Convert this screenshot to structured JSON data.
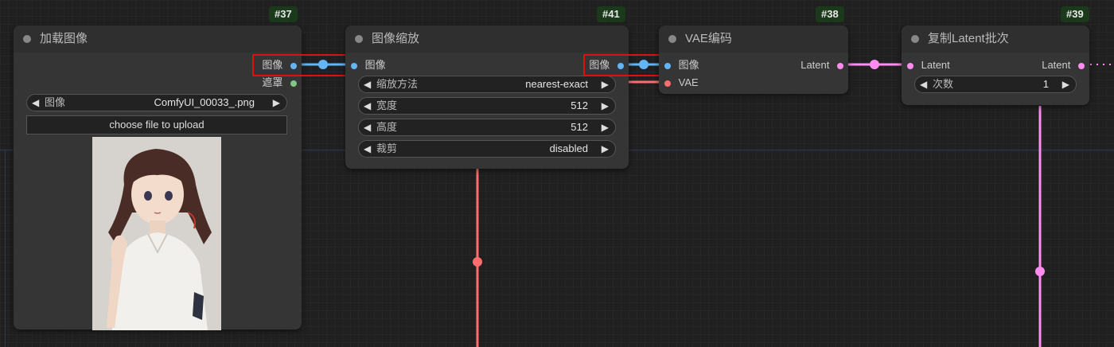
{
  "canvas": {
    "background": "#202020",
    "grid_color": "#2c2c2c"
  },
  "colors": {
    "image_link": "#64b5f6",
    "latent_link": "#ff8cf0",
    "vae_link": "#ff6e6e",
    "mask_slot": "#81c784",
    "highlight": "#e01010",
    "badge_bg": "#1b3a1b"
  },
  "nodes": {
    "load_image": {
      "id": "#37",
      "title": "加载图像",
      "outputs": {
        "image": "图像",
        "mask": "遮罩"
      },
      "widget_image": {
        "label": "图像",
        "value": "ComfyUI_00033_.png"
      },
      "upload_label": "choose file to upload",
      "preview_icon": "anime-girl-portrait-image"
    },
    "image_scale": {
      "id": "#41",
      "title": "图像缩放",
      "input_image": "图像",
      "output_image": "图像",
      "widgets": [
        {
          "label": "缩放方法",
          "value": "nearest-exact"
        },
        {
          "label": "宽度",
          "value": "512"
        },
        {
          "label": "高度",
          "value": "512"
        },
        {
          "label": "裁剪",
          "value": "disabled"
        }
      ]
    },
    "vae_encode": {
      "id": "#38",
      "title": "VAE编码",
      "inputs": {
        "pixels": "图像",
        "vae": "VAE"
      },
      "output": "Latent"
    },
    "repeat_latent": {
      "id": "#39",
      "title": "复制Latent批次",
      "input": "Latent",
      "output": "Latent",
      "widget_amount": {
        "label": "次数",
        "value": "1"
      }
    }
  }
}
